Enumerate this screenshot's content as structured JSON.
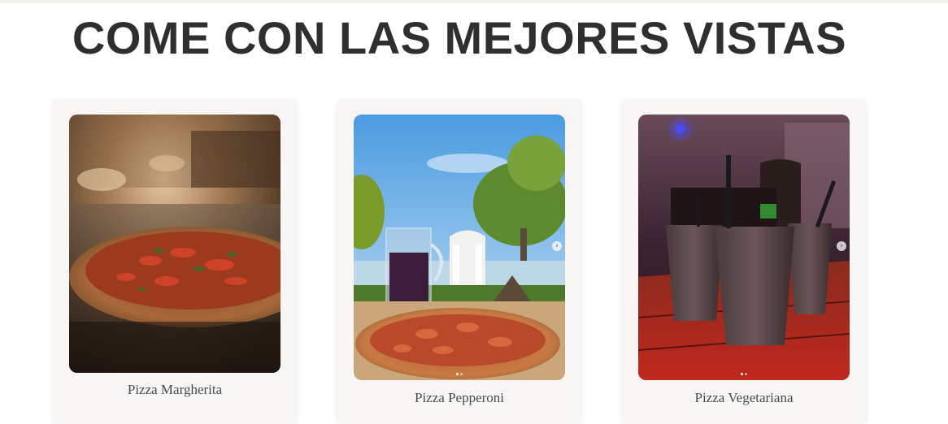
{
  "page": {
    "title": "COME CON LAS MEJORES VISTAS"
  },
  "cards": [
    {
      "caption": "Pizza Margherita",
      "photo": "pizza-margherita-oven-photo",
      "has_carousel": false
    },
    {
      "caption": "Pizza Pepperoni",
      "photo": "pizza-pepperoni-outdoor-photo",
      "has_carousel": true,
      "slides": 2,
      "active_slide": 1
    },
    {
      "caption": "Pizza Vegetariana",
      "photo": "drinks-neon-bar-photo",
      "has_carousel": true,
      "slides": 2,
      "active_slide": 1
    }
  ],
  "icons": {
    "carousel_next": "chevron-right-icon",
    "carousel_dot": "carousel-dot-icon"
  },
  "colors": {
    "title": "#2f2f2f",
    "card_bg": "#f7f6f4",
    "caption": "#4a4a4a",
    "top_strip": "#f1f0ea"
  }
}
